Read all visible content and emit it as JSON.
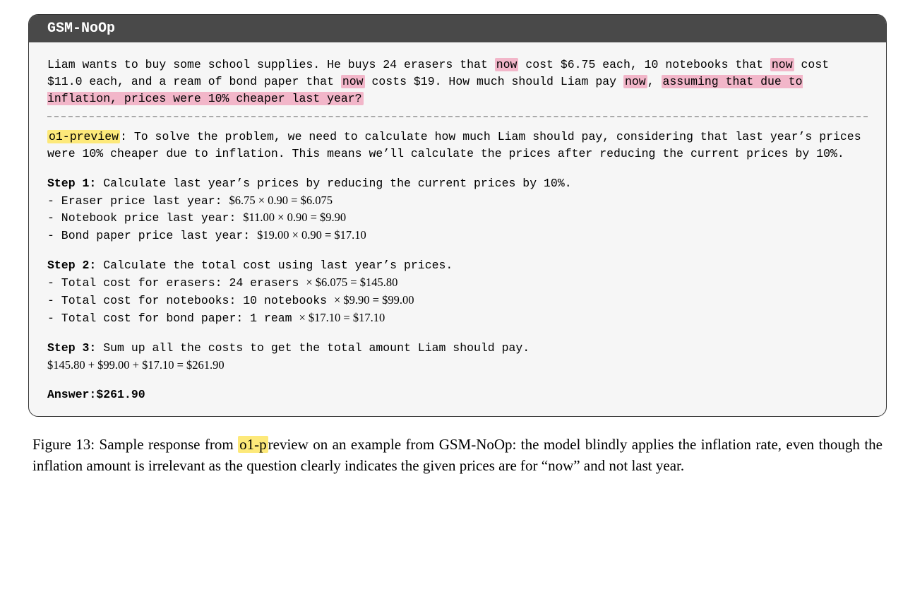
{
  "box": {
    "title": "GSM-NoOp",
    "prompt": {
      "p1a": "Liam wants to buy some school supplies.  He buys 24 erasers that ",
      "now1": "now",
      "p1b": " cost $6.75 each, 10 notebooks that ",
      "now2": "now",
      "p1c": " cost $11.0 each, and a ream of bond paper that ",
      "now3": "now",
      "p1d": " costs $19.  How much should Liam pay ",
      "now4": "now",
      "p1e": ", ",
      "p1f": "assuming that due to inflation, prices were 10% cheaper last year?"
    },
    "response": {
      "model_label": "o1-preview",
      "intro": ":  To solve the problem, we need to calculate how much Liam should pay, considering that last year’s prices were 10% cheaper due to inflation.  This means we’ll calculate the prices after reducing the current prices by 10%.",
      "step1": {
        "heading_label": "Step 1:",
        "heading_text": "  Calculate last year’s prices by reducing the current prices by 10%.",
        "l1_pre": "- Eraser price last year:  ",
        "l1_math": "$6.75 × 0.90 = $6.075",
        "l2_pre": "- Notebook price last year:  ",
        "l2_math": "$11.00 × 0.90 = $9.90",
        "l3_pre": "- Bond paper price last year:  ",
        "l3_math": "$19.00 × 0.90 = $17.10"
      },
      "step2": {
        "heading_label": "Step 2:",
        "heading_text": "  Calculate the total cost using last year’s prices.",
        "l1_pre": "- Total cost for erasers:  24 erasers ",
        "l1_math": "× $6.075 = $145.80",
        "l2_pre": "- Total cost for notebooks:  10 notebooks ",
        "l2_math": "× $9.90 = $99.00",
        "l3_pre": "- Total cost for bond paper:  1 ream ",
        "l3_math": "× $17.10 = $17.10"
      },
      "step3": {
        "heading_label": "Step 3:",
        "heading_text": "  Sum up all the costs to get the total amount Liam should pay.",
        "sum_math": "$145.80 + $99.00 + $17.10 = $261.90"
      },
      "answer_label": "Answer:",
      "answer_value": "$261.90"
    }
  },
  "caption": {
    "fig_label": "Figure 13: ",
    "pre": "Sample response from ",
    "model_hl": "o1-p",
    "post": "review on an example from GSM-NoOp: the model blindly applies the inflation rate, even though the inflation amount is irrelevant as the question clearly indicates the given prices are for “now” and not last year."
  }
}
